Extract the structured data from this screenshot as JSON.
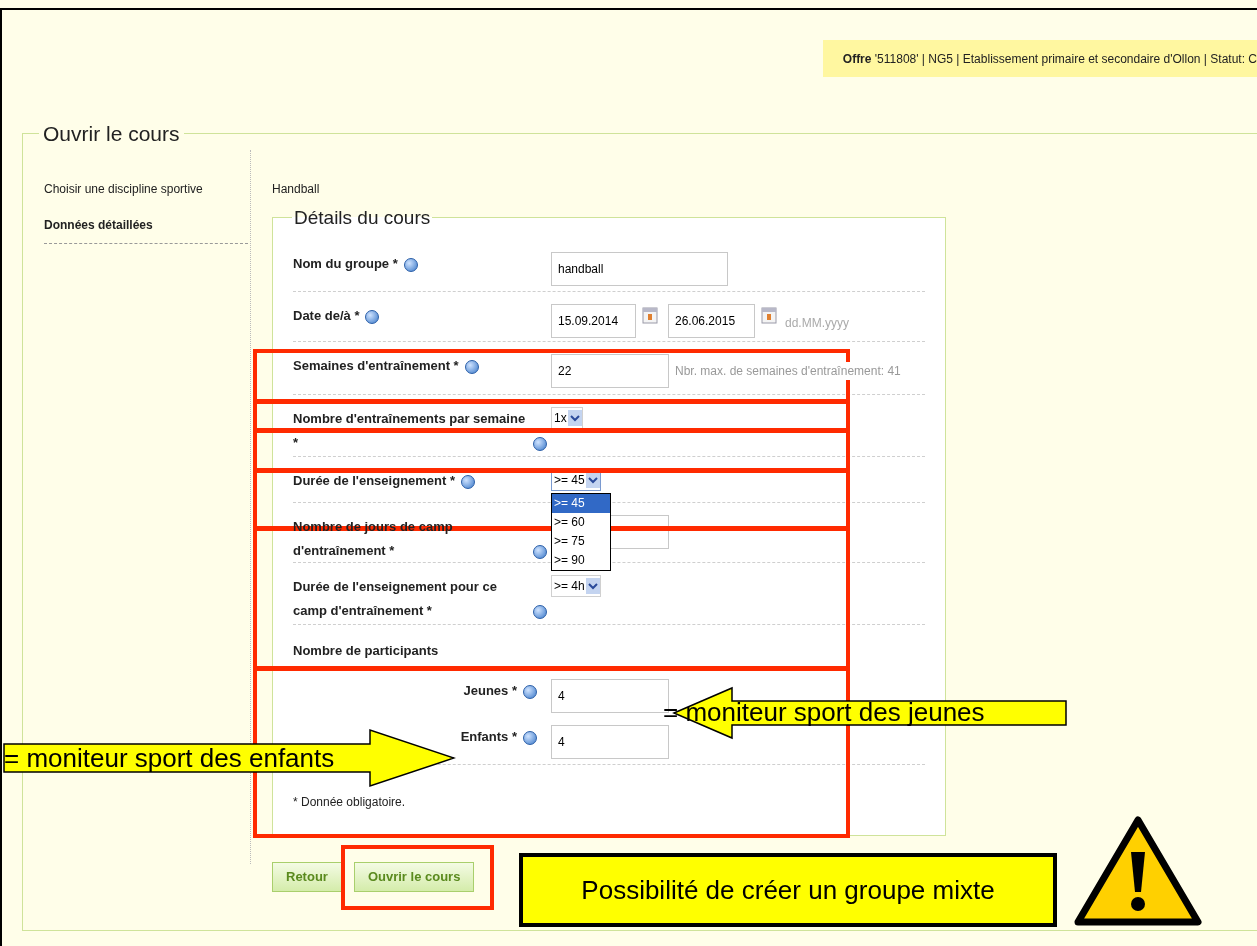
{
  "header": {
    "offer": "**Offre** '511808' | NG5 | Etablissement primaire et secondaire d'Ollon | Statut: C"
  },
  "section_title": "Ouvrir le cours",
  "steps": [
    {
      "label": "Choisir une discipline sportive",
      "selected": false
    },
    {
      "label": "Données détaillées",
      "selected": true
    }
  ],
  "discipline": "Handball",
  "details": {
    "title": "Détails du cours",
    "rows": [
      {
        "kind": "text",
        "label": "Nom du groupe *",
        "help": true,
        "value": "handball"
      },
      {
        "kind": "dates",
        "label": "Date de/à *",
        "help": true,
        "from": "15.09.2014",
        "to": "26.06.2015",
        "format": "dd.MM.yyyy"
      },
      {
        "kind": "text",
        "label": "Semaines d'entraînement *",
        "help": true,
        "value": "22",
        "hint": "Nbr. max. de semaines d'entraînement: 41"
      },
      {
        "kind": "select",
        "label": "Nombre d'entraînements par semaine *",
        "help": true,
        "value": "1x"
      },
      {
        "kind": "select",
        "label": "Durée de l'enseignement *",
        "help": true,
        "value": ">= 45",
        "expanded": true,
        "options": [
          {
            "label": ">= 45",
            "selected": true
          },
          {
            "label": ">= 60",
            "selected": false
          },
          {
            "label": ">= 75",
            "selected": false
          },
          {
            "label": ">= 90",
            "selected": false
          }
        ]
      },
      {
        "kind": "text",
        "label": "Nombre de jours de camp d'entraînement *",
        "help": true,
        "value": ""
      },
      {
        "kind": "select",
        "label": "Durée de l'enseignement pour ce camp d'entraînement *",
        "help": true,
        "value": ">= 4h"
      },
      {
        "kind": "heading",
        "label": "Nombre de participants"
      },
      {
        "kind": "sub",
        "label": "Jeunes *",
        "help": true,
        "value": "4"
      },
      {
        "kind": "sub",
        "label": "Enfants *",
        "help": true,
        "value": "4"
      }
    ],
    "note": "* Donnée obligatoire."
  },
  "buttons": [
    {
      "label": "Retour"
    },
    {
      "label": "Ouvrir le cours"
    }
  ],
  "annotations": [
    {
      "kind": "arrow_left",
      "text": "= moniteur sport des jeunes"
    },
    {
      "kind": "arrow_right",
      "text": "= moniteur sport des enfants"
    },
    {
      "kind": "callout",
      "text": "Possibilité de créer un groupe mixte"
    },
    {
      "kind": "warning"
    }
  ]
}
